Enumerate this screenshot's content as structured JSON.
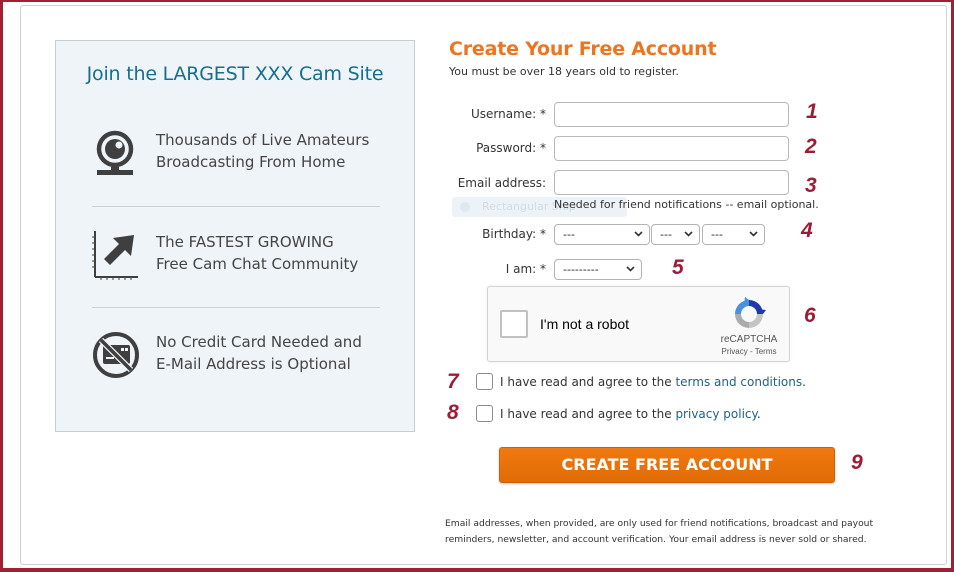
{
  "promo": {
    "title": "Join the LARGEST XXX Cam Site",
    "features": [
      {
        "icon": "webcam-icon",
        "line1": "Thousands of Live Amateurs",
        "line2": "Broadcasting From Home"
      },
      {
        "icon": "growth-chart-icon",
        "line1": "The FASTEST GROWING",
        "line2": "Free Cam Chat Community"
      },
      {
        "icon": "no-credit-card-icon",
        "line1": "No Credit Card Needed and",
        "line2": "E-Mail Address is Optional"
      }
    ]
  },
  "form": {
    "title": "Create Your Free Account",
    "subtitle": "You must be over 18 years old to register.",
    "username": {
      "label": "Username: *",
      "value": "",
      "placeholder": ""
    },
    "password": {
      "label": "Password: *",
      "value": "",
      "placeholder": ""
    },
    "email": {
      "label": "Email address:",
      "value": "",
      "placeholder": "",
      "hint": "Needed for friend notifications -- email optional."
    },
    "ghost_tooltip": "Rectangular Snip",
    "birthday": {
      "label": "Birthday: *",
      "month": "---",
      "day": "---",
      "year": "---"
    },
    "gender": {
      "label": "I am: *",
      "value": "---------"
    },
    "recaptcha": {
      "label": "I'm not a robot",
      "brand": "reCAPTCHA",
      "privacy": "Privacy",
      "separator": " - ",
      "terms": "Terms"
    },
    "terms_agree": {
      "prefix": "I have read and agree to the ",
      "link": "terms and conditions",
      "suffix": "."
    },
    "privacy_agree": {
      "prefix": "I have read and agree to the ",
      "link": "privacy policy",
      "suffix": "."
    },
    "submit_label": "CREATE FREE ACCOUNT",
    "footnote": "Email addresses, when provided, are only used for friend notifications, broadcast and payout reminders, newsletter, and account verification. Your email address is never sold or shared."
  },
  "annotations": [
    "1",
    "2",
    "3",
    "4",
    "5",
    "6",
    "7",
    "8",
    "9"
  ],
  "colors": {
    "accent_orange": "#ec7521",
    "promo_title": "#156f8d",
    "annotation": "#9c1c37",
    "link": "#1c6488",
    "frame": "#a31f34"
  }
}
